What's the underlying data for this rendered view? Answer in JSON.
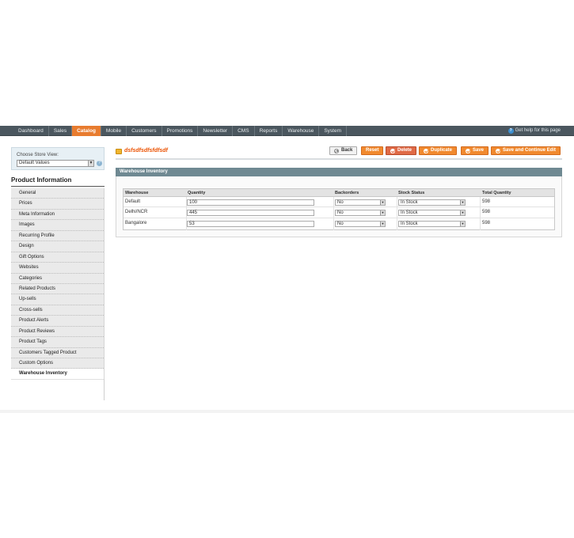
{
  "nav": {
    "items": [
      "Dashboard",
      "Sales",
      "Catalog",
      "Mobile",
      "Customers",
      "Promotions",
      "Newsletter",
      "CMS",
      "Reports",
      "Warehouse",
      "System"
    ],
    "help": "Get help for this page"
  },
  "store": {
    "label": "Choose Store View:",
    "value": "Default Values"
  },
  "product": {
    "section_title": "Product Information",
    "tabs": [
      "General",
      "Prices",
      "Meta Information",
      "Images",
      "Recurring Profile",
      "Design",
      "Gift Options",
      "Websites",
      "Categories",
      "Related Products",
      "Up-sells",
      "Cross-sells",
      "Product Alerts",
      "Product Reviews",
      "Product Tags",
      "Customers Tagged Product",
      "Custom Options",
      "Warehouse Inventory"
    ]
  },
  "header": {
    "title": "dsfsdfsdfsfdfsdf",
    "buttons": {
      "back": "Back",
      "reset": "Reset",
      "delete": "Delete",
      "duplicate": "Duplicate",
      "save": "Save",
      "save_continue": "Save and Continue Edit"
    }
  },
  "inventory": {
    "heading": "Warehouse Inventory",
    "columns": [
      "Warehouse",
      "Quantity",
      "Backorders",
      "Stock Status",
      "Total Quantity"
    ],
    "rows": [
      {
        "warehouse": "Default",
        "quantity": "100",
        "backorders": "No",
        "stock": "In Stock",
        "total": "598"
      },
      {
        "warehouse": "Delhi/NCR",
        "quantity": "445",
        "backorders": "No",
        "stock": "In Stock",
        "total": "598"
      },
      {
        "warehouse": "Bangalore",
        "quantity": "53",
        "backorders": "No",
        "stock": "In Stock",
        "total": "598"
      }
    ]
  },
  "colors": {
    "nav_bg": "#4b575f",
    "accent": "#f18a2f",
    "section_head": "#6f8992"
  }
}
